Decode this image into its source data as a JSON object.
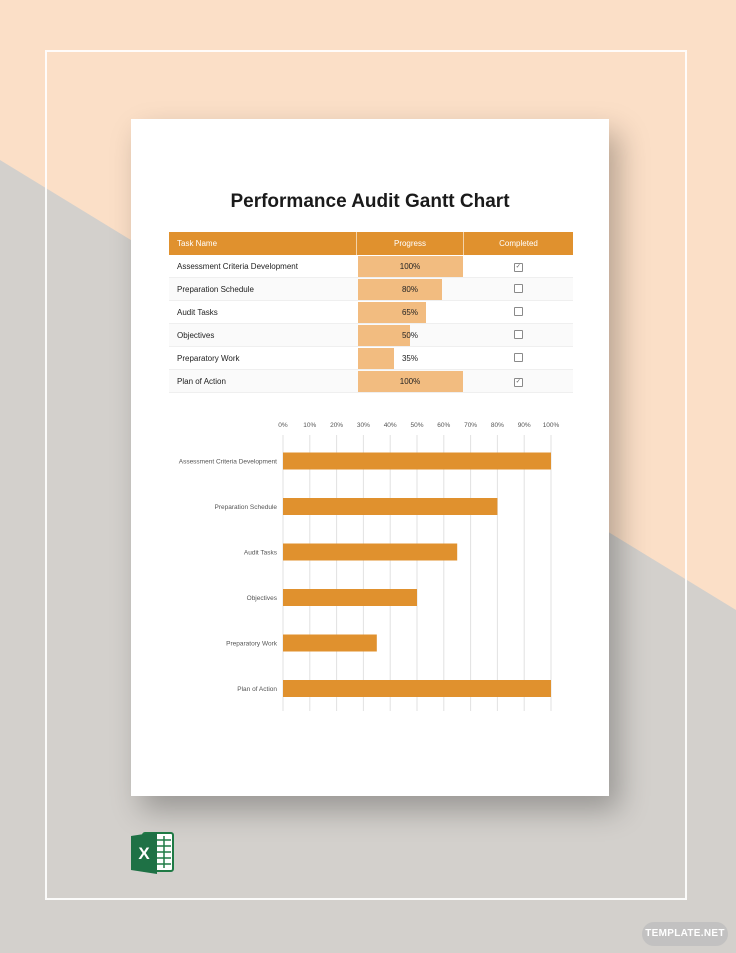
{
  "document": {
    "title": "Performance Audit Gantt Chart"
  },
  "table": {
    "headers": [
      "Task Name",
      "Progress",
      "Completed"
    ],
    "rows": [
      {
        "task": "Assessment Criteria Development",
        "progress_label": "100%",
        "progress": 1.0,
        "completed": true
      },
      {
        "task": "Preparation Schedule",
        "progress_label": "80%",
        "progress": 0.8,
        "completed": false
      },
      {
        "task": "Audit Tasks",
        "progress_label": "65%",
        "progress": 0.65,
        "completed": false
      },
      {
        "task": "Objectives",
        "progress_label": "50%",
        "progress": 0.5,
        "completed": false
      },
      {
        "task": "Preparatory Work",
        "progress_label": "35%",
        "progress": 0.35,
        "completed": false
      },
      {
        "task": "Plan of Action",
        "progress_label": "100%",
        "progress": 1.0,
        "completed": true
      }
    ]
  },
  "chart_data": {
    "type": "bar",
    "orientation": "horizontal",
    "categories": [
      "Assessment Criteria Development",
      "Preparation Schedule",
      "Audit Tasks",
      "Objectives",
      "Preparatory Work",
      "Plan of Action"
    ],
    "values": [
      100,
      80,
      65,
      50,
      35,
      100
    ],
    "x_ticks": [
      "0%",
      "10%",
      "20%",
      "30%",
      "40%",
      "50%",
      "60%",
      "70%",
      "80%",
      "90%",
      "100%"
    ],
    "xlim": [
      0,
      100
    ],
    "x_axis_position": "top",
    "grid": true,
    "bar_color": "#e0912e"
  },
  "branding": {
    "badge": "TEMPLATE.NET",
    "app_icon": "excel-icon",
    "app_icon_letter": "X"
  },
  "colors": {
    "accent": "#e0912e",
    "progress_fill": "#f2bc80",
    "bg_peach": "#fbdfc7",
    "bg_gray": "#d3d0cc"
  }
}
